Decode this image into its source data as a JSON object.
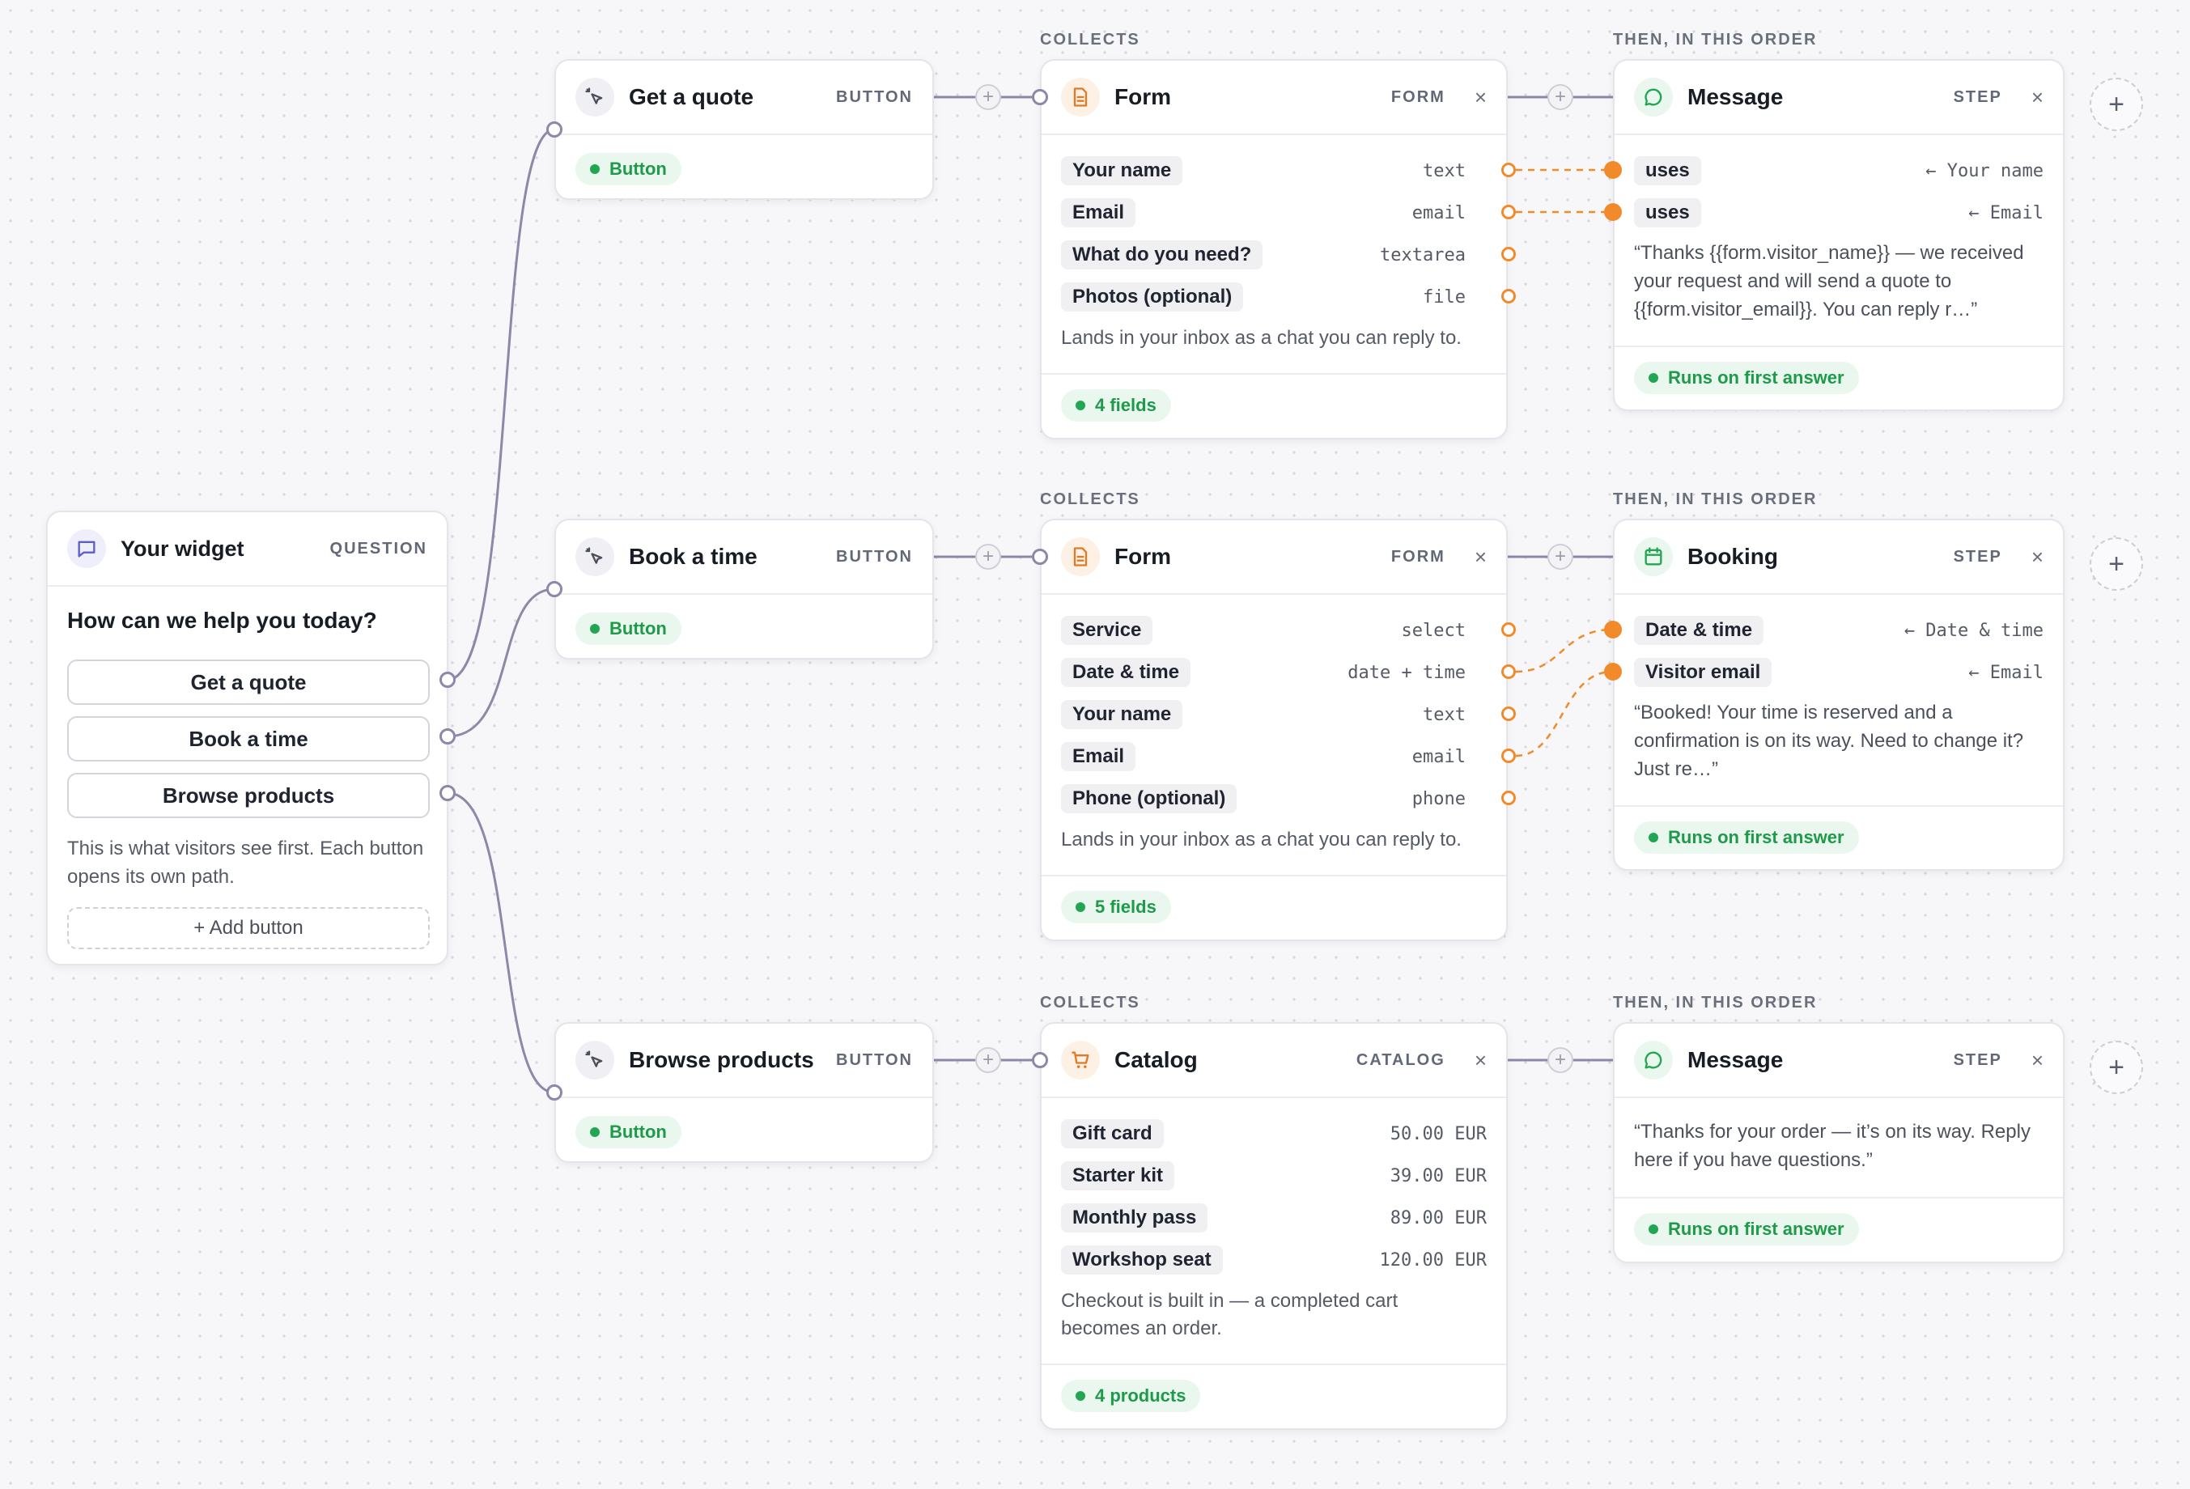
{
  "widget": {
    "title": "Your widget",
    "tag": "QUESTION",
    "question": "How can we help you today?",
    "buttons": [
      "Get a quote",
      "Book a time",
      "Browse products"
    ],
    "description": "This is what visitors see first. Each button opens its own path.",
    "add_button": "+ Add button"
  },
  "labels": {
    "collects": "COLLECTS",
    "then": "THEN, IN THIS ORDER",
    "plus": "+"
  },
  "paths": [
    {
      "button": {
        "title": "Get a quote",
        "tag": "BUTTON",
        "pill": "Button"
      },
      "collector": {
        "title": "Form",
        "tag": "FORM",
        "close": "×",
        "rows": [
          {
            "label": "Your name",
            "type": "text"
          },
          {
            "label": "Email",
            "type": "email"
          },
          {
            "label": "What do you need?",
            "type": "textarea"
          },
          {
            "label": "Photos (optional)",
            "type": "file"
          }
        ],
        "note": "Lands in your inbox as a chat you can reply to.",
        "pill": "4 fields"
      },
      "step": {
        "title": "Message",
        "tag": "STEP",
        "close": "×",
        "uses": [
          {
            "label": "uses",
            "source": "← Your name"
          },
          {
            "label": "uses",
            "source": "← Email"
          }
        ],
        "text": "“Thanks {{form.visitor_name}} — we received your request and will send a quote to {{form.visitor_email}}. You can reply r…”",
        "pill": "Runs on first answer"
      }
    },
    {
      "button": {
        "title": "Book a time",
        "tag": "BUTTON",
        "pill": "Button"
      },
      "collector": {
        "title": "Form",
        "tag": "FORM",
        "close": "×",
        "rows": [
          {
            "label": "Service",
            "type": "select"
          },
          {
            "label": "Date & time",
            "type": "date + time"
          },
          {
            "label": "Your name",
            "type": "text"
          },
          {
            "label": "Email",
            "type": "email"
          },
          {
            "label": "Phone (optional)",
            "type": "phone"
          }
        ],
        "note": "Lands in your inbox as a chat you can reply to.",
        "pill": "5 fields"
      },
      "step": {
        "title": "Booking",
        "tag": "STEP",
        "close": "×",
        "uses": [
          {
            "label": "Date & time",
            "source": "← Date & time"
          },
          {
            "label": "Visitor email",
            "source": "← Email"
          }
        ],
        "text": "“Booked! Your time is reserved and a confirmation is on its way. Need to change it? Just re…”",
        "pill": "Runs on first answer"
      }
    },
    {
      "button": {
        "title": "Browse products",
        "tag": "BUTTON",
        "pill": "Button"
      },
      "collector": {
        "title": "Catalog",
        "tag": "CATALOG",
        "close": "×",
        "rows": [
          {
            "label": "Gift card",
            "type": "50.00 EUR"
          },
          {
            "label": "Starter kit",
            "type": "39.00 EUR"
          },
          {
            "label": "Monthly pass",
            "type": "89.00 EUR"
          },
          {
            "label": "Workshop seat",
            "type": "120.00 EUR"
          }
        ],
        "note": "Checkout is built in — a completed cart becomes an order.",
        "pill": "4 products"
      },
      "step": {
        "title": "Message",
        "tag": "STEP",
        "close": "×",
        "uses": [],
        "text": "“Thanks for your order — it’s on its way. Reply here if you have questions.”",
        "pill": "Runs on first answer"
      }
    }
  ],
  "colors": {
    "accent_orange": "#f08a2a",
    "wire": "#8d88a8",
    "success": "#22a653",
    "widget_icon": "#5b5bd6",
    "message_icon": "#22a653"
  },
  "icons": {
    "widget": "chat-bubble-icon",
    "button": "cursor-click-icon",
    "form": "document-icon",
    "catalog": "cart-icon",
    "message": "message-circle-icon",
    "booking": "calendar-icon"
  }
}
